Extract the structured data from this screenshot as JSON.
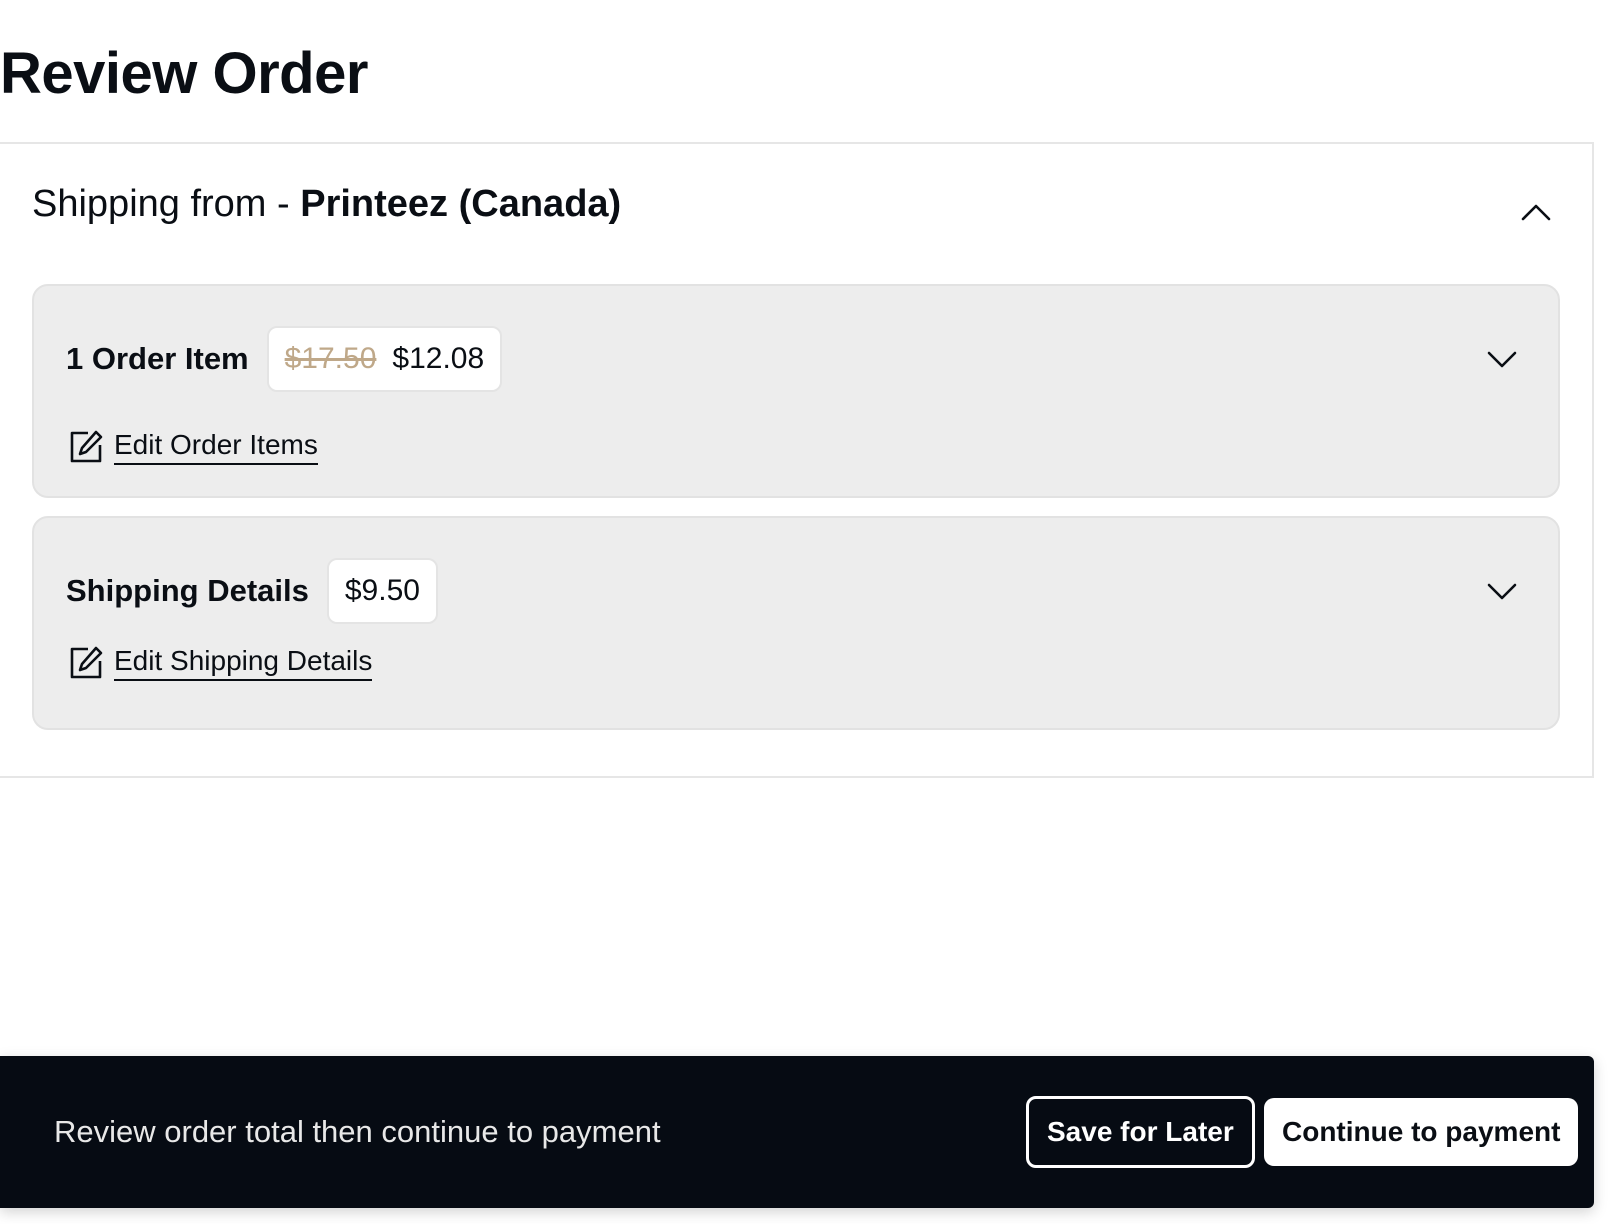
{
  "page": {
    "title": "Review Order"
  },
  "shipping_section": {
    "prefix": "Shipping from - ",
    "vendor": "Printeez (Canada)",
    "toggle_icon": "chevron-up-icon"
  },
  "order_items": {
    "title": "1 Order Item",
    "original_price": "$17.50",
    "price": "$12.08",
    "expand_icon": "chevron-down-icon",
    "edit_label": "Edit Order Items",
    "edit_icon": "edit-icon"
  },
  "shipping_details": {
    "title": "Shipping Details",
    "price": "$9.50",
    "expand_icon": "chevron-down-icon",
    "edit_label": "Edit Shipping Details",
    "edit_icon": "edit-icon"
  },
  "footer": {
    "prompt": "Review order total then continue to payment",
    "save_label": "Save for Later",
    "continue_label": "Continue to payment"
  },
  "colors": {
    "primary_dark": "#060b13",
    "panel_bg": "#ededed",
    "strikethrough_price": "#bfa889"
  }
}
